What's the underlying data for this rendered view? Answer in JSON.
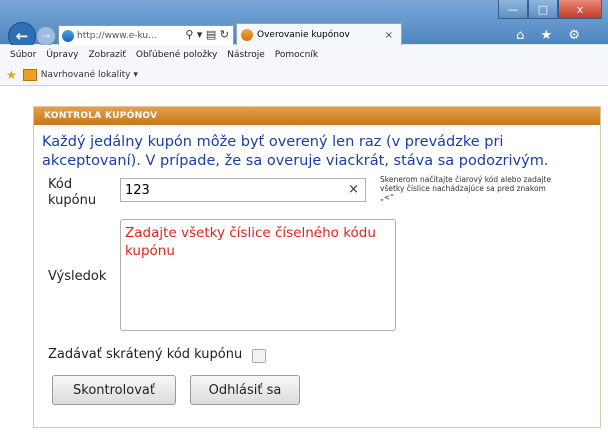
{
  "browser": {
    "url": "http://www.e-ku...",
    "url_controls": "⚲ ▾ ▤ ↻",
    "tab_title": "Overovanie kupónov",
    "tab_close": "×",
    "right_icons": "⌂ ★ ⚙"
  },
  "window": {
    "minimize": "—",
    "maximize": "□",
    "close": "x"
  },
  "menu": [
    "Súbor",
    "Úpravy",
    "Zobraziť",
    "Obľúbené položky",
    "Nástroje",
    "Pomocník"
  ],
  "favorites": {
    "item": "Navrhované lokality ▾"
  },
  "panel": {
    "title": "KONTROLA KUPÓNOV",
    "intro": "Každý jedálny kupón môže byť overený len raz (v prevádzke pri akceptovaní). V prípade, že sa overuje viackrát, stáva sa podozrivým.",
    "coupon_label_1": "Kód",
    "coupon_label_2": "kupónu",
    "coupon_value": "123",
    "clear": "×",
    "hint": "Skenerom načítajte čiarový kód alebo zadajte všetky číslice nachádzajúce sa pred znakom „<“",
    "result_label": "Výsledok",
    "result_text": "Zadajte všetky číslice číselného kódu kupónu",
    "short_code_label": "Zadávať skrátený kód kupónu",
    "check_button": "Skontrolovať",
    "logout_button": "Odhlásiť sa"
  }
}
